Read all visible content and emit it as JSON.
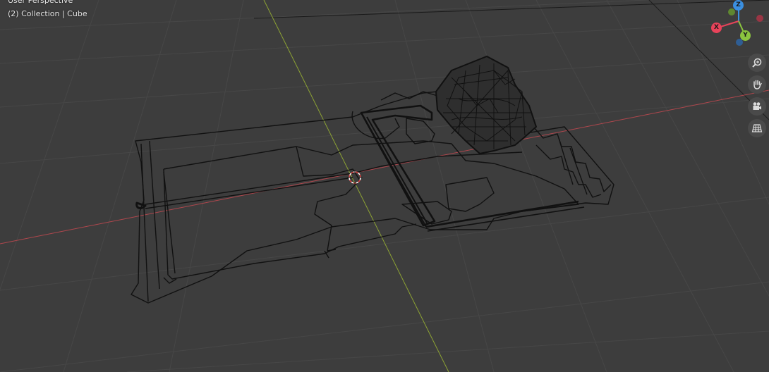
{
  "viewport": {
    "title": "User Perspective",
    "collection_label": "(2) Collection | Cube"
  },
  "gizmo": {
    "x_label": "X",
    "y_label": "Y",
    "z_label": "Z",
    "colors": {
      "x": "#e8435a",
      "y": "#8bc43f",
      "z": "#3b8fe0",
      "neg_x": "#9a3544",
      "neg_y": "#5f8730",
      "neg_z": "#2f5e94"
    }
  },
  "navigation": {
    "icons": [
      "zoom-icon",
      "hand-icon",
      "camera-icon",
      "grid-icon"
    ]
  },
  "colors": {
    "background": "#3d3d3d",
    "grid": "#464646",
    "x_axis": "#b0474d",
    "y_axis": "#8da334",
    "wire": "#111111"
  }
}
